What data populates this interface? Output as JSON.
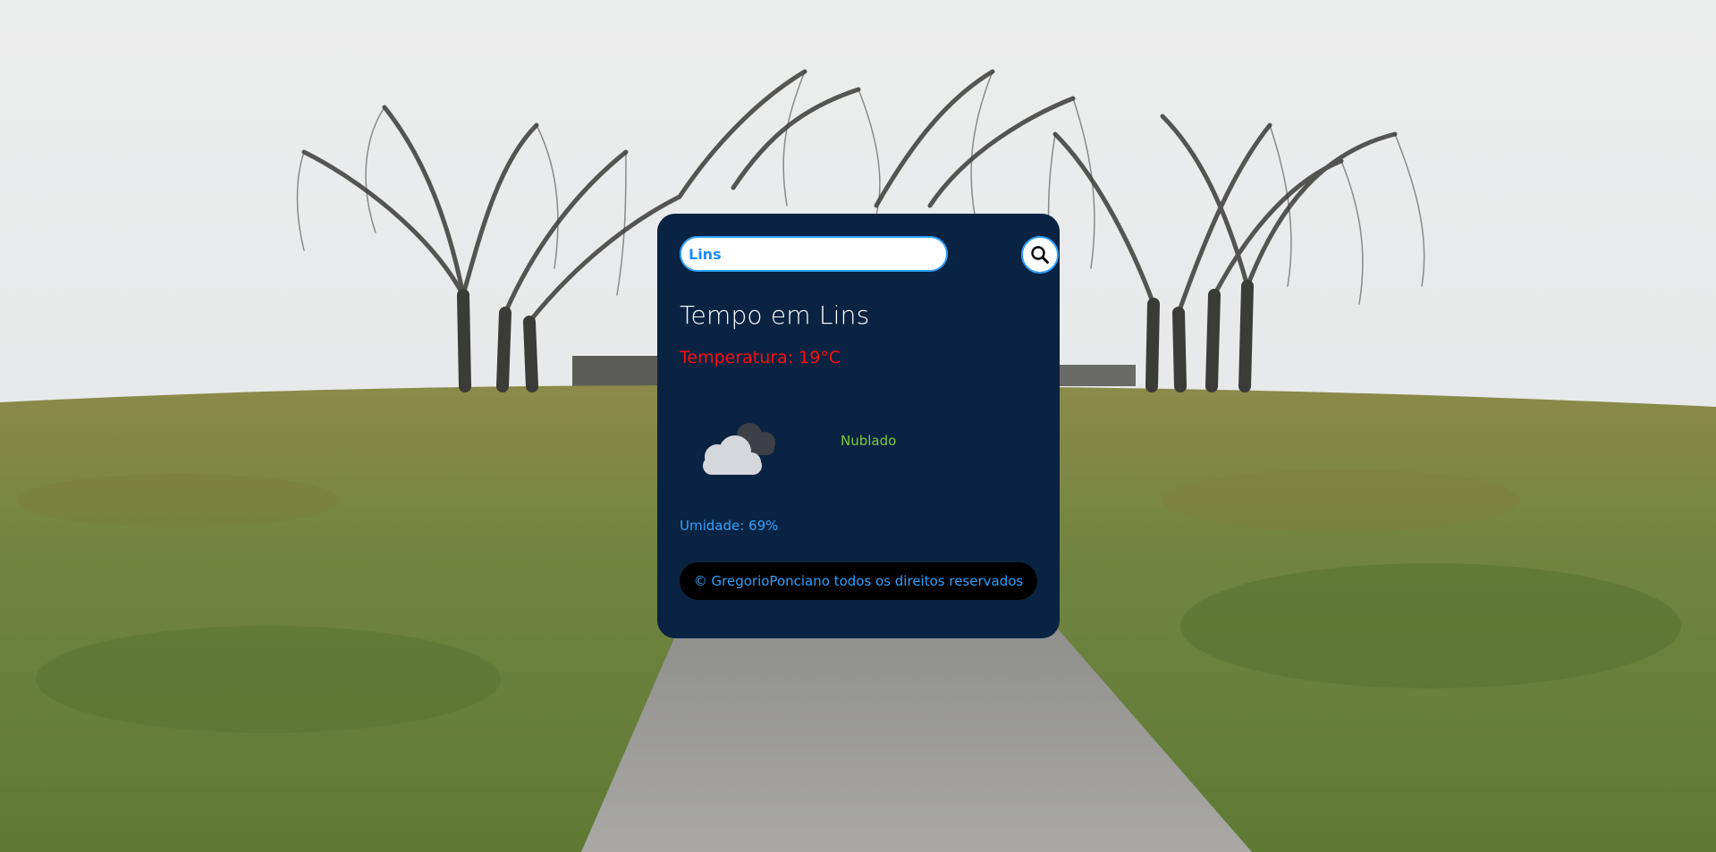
{
  "search": {
    "value": "Lins",
    "button_icon": "search-icon"
  },
  "weather": {
    "title": "Tempo em Lins",
    "temperature": "Temperatura: 19°C",
    "description": "Nublado",
    "humidity": "Umidade: 69%",
    "icon": "cloudy-icon"
  },
  "footer": {
    "text": "© GregorioPonciano todos os direitos reservados"
  },
  "colors": {
    "card": "#0a2342",
    "temperature": "#ff0d0d",
    "description": "#7fc63a",
    "accent": "#2fa1ff",
    "footer_bg": "#000000"
  }
}
